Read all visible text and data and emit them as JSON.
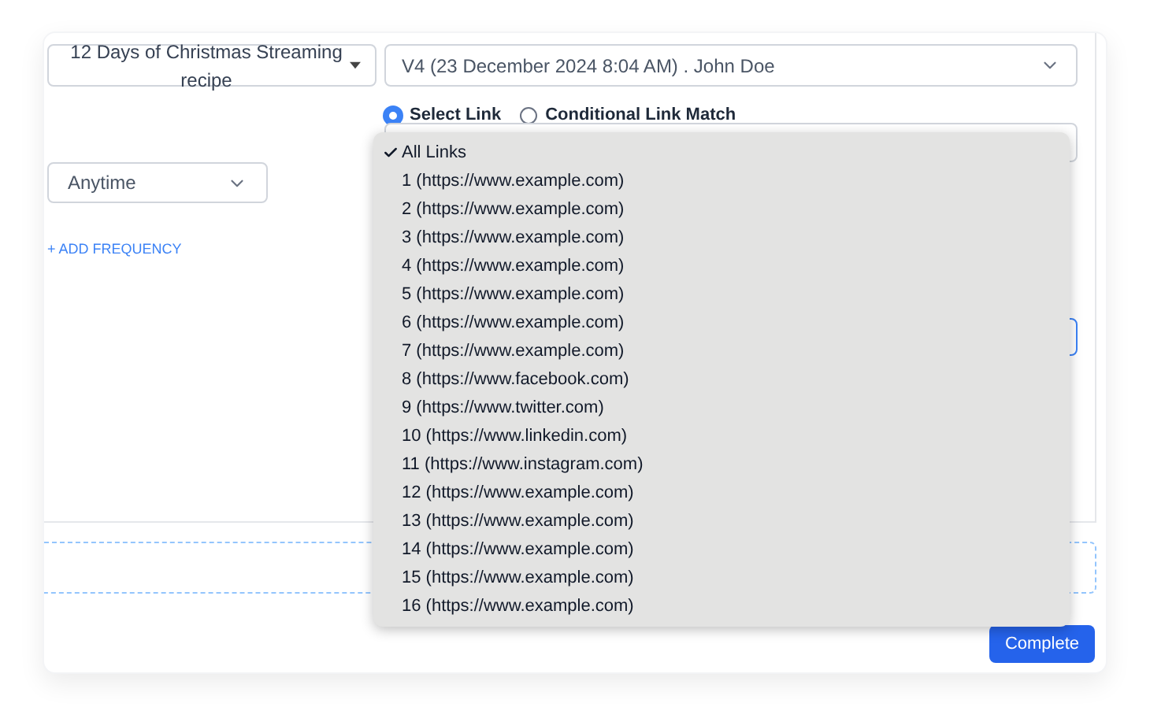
{
  "recipe_dropdown": {
    "value": "12 Days of Christmas Streaming recipe"
  },
  "version_select": {
    "value": "V4 (23 December 2024 8:04 AM) . John Doe"
  },
  "link_mode": [
    {
      "label": "Select Link",
      "selected": true
    },
    {
      "label": "Conditional Link Match",
      "selected": false
    }
  ],
  "frequency_select": {
    "value": "Anytime"
  },
  "add_frequency_link": "+ ADD FREQUENCY",
  "link_menu": {
    "items": [
      {
        "label": "All Links",
        "checked": true
      },
      {
        "label": "1 (https://www.example.com)",
        "checked": false
      },
      {
        "label": "2 (https://www.example.com)",
        "checked": false
      },
      {
        "label": "3 (https://www.example.com)",
        "checked": false
      },
      {
        "label": "4 (https://www.example.com)",
        "checked": false
      },
      {
        "label": "5 (https://www.example.com)",
        "checked": false
      },
      {
        "label": "6 (https://www.example.com)",
        "checked": false
      },
      {
        "label": "7 (https://www.example.com)",
        "checked": false
      },
      {
        "label": "8 (https://www.facebook.com)",
        "checked": false
      },
      {
        "label": "9 (https://www.twitter.com)",
        "checked": false
      },
      {
        "label": "10 (https://www.linkedin.com)",
        "checked": false
      },
      {
        "label": "11 (https://www.instagram.com)",
        "checked": false
      },
      {
        "label": "12 (https://www.example.com)",
        "checked": false
      },
      {
        "label": "13 (https://www.example.com)",
        "checked": false
      },
      {
        "label": "14 (https://www.example.com)",
        "checked": false
      },
      {
        "label": "15 (https://www.example.com)",
        "checked": false
      },
      {
        "label": "16 (https://www.example.com)",
        "checked": false
      }
    ]
  },
  "complete_button": "Complete"
}
